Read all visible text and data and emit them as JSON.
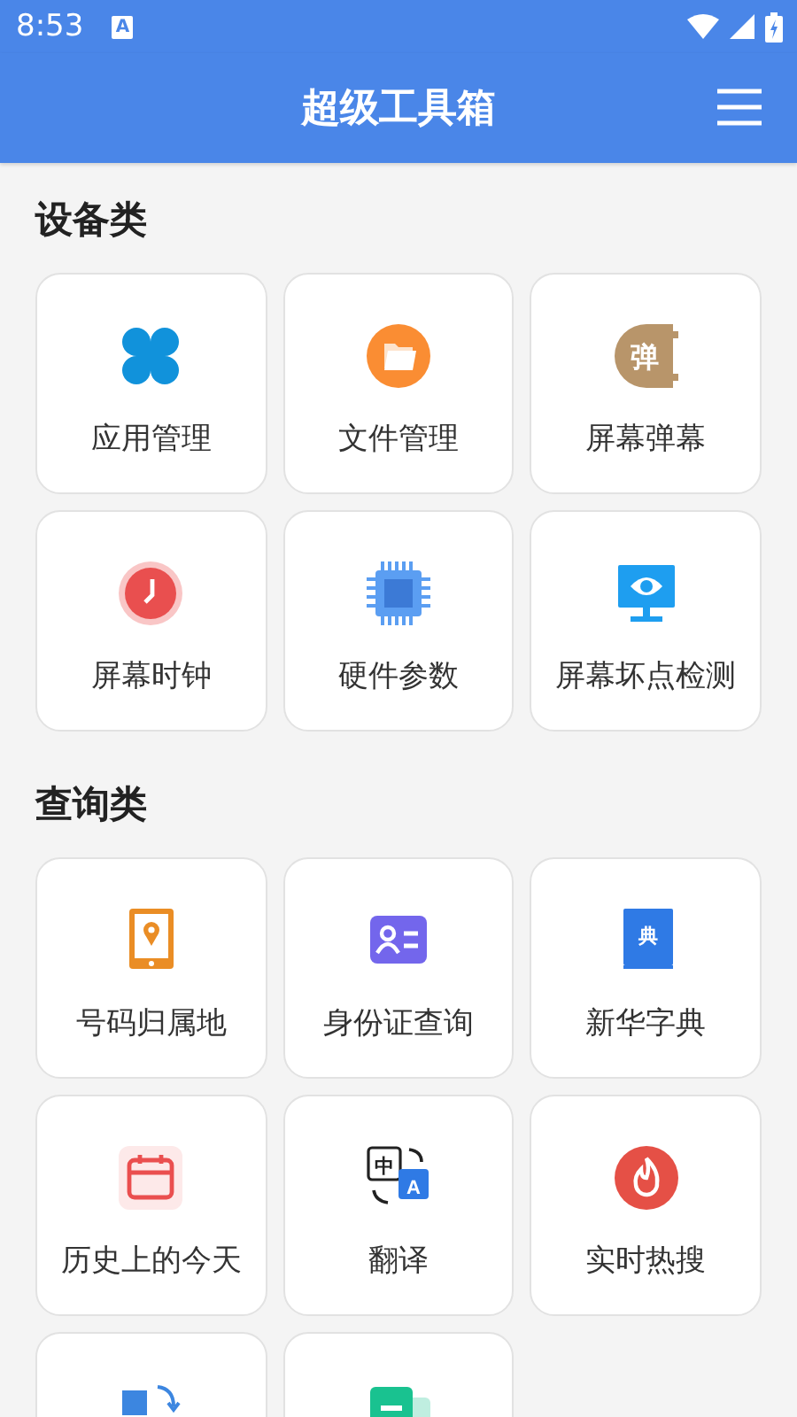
{
  "status_bar": {
    "time": "8:53",
    "notification_icon_text": "A"
  },
  "app_bar": {
    "title": "超级工具箱"
  },
  "sections": [
    {
      "title": "设备类",
      "tools": [
        {
          "label": "应用管理",
          "kind": "clover"
        },
        {
          "label": "文件管理",
          "kind": "folder"
        },
        {
          "label": "屏幕弹幕",
          "kind": "badge",
          "icon_text": "弹"
        },
        {
          "label": "屏幕时钟",
          "kind": "clock"
        },
        {
          "label": "硬件参数",
          "kind": "chip"
        },
        {
          "label": "屏幕坏点检测",
          "kind": "monitor"
        }
      ]
    },
    {
      "title": "查询类",
      "tools": [
        {
          "label": "号码归属地",
          "kind": "phone"
        },
        {
          "label": "身份证查询",
          "kind": "idcard"
        },
        {
          "label": "新华字典",
          "kind": "book",
          "icon_text": "典"
        },
        {
          "label": "历史上的今天",
          "kind": "calendar"
        },
        {
          "label": "翻译",
          "kind": "translate",
          "icon_text": "中",
          "icon_text_2": "A"
        },
        {
          "label": "实时热搜",
          "kind": "fire"
        },
        {
          "kind": "convert"
        },
        {
          "kind": "doc"
        }
      ]
    }
  ]
}
